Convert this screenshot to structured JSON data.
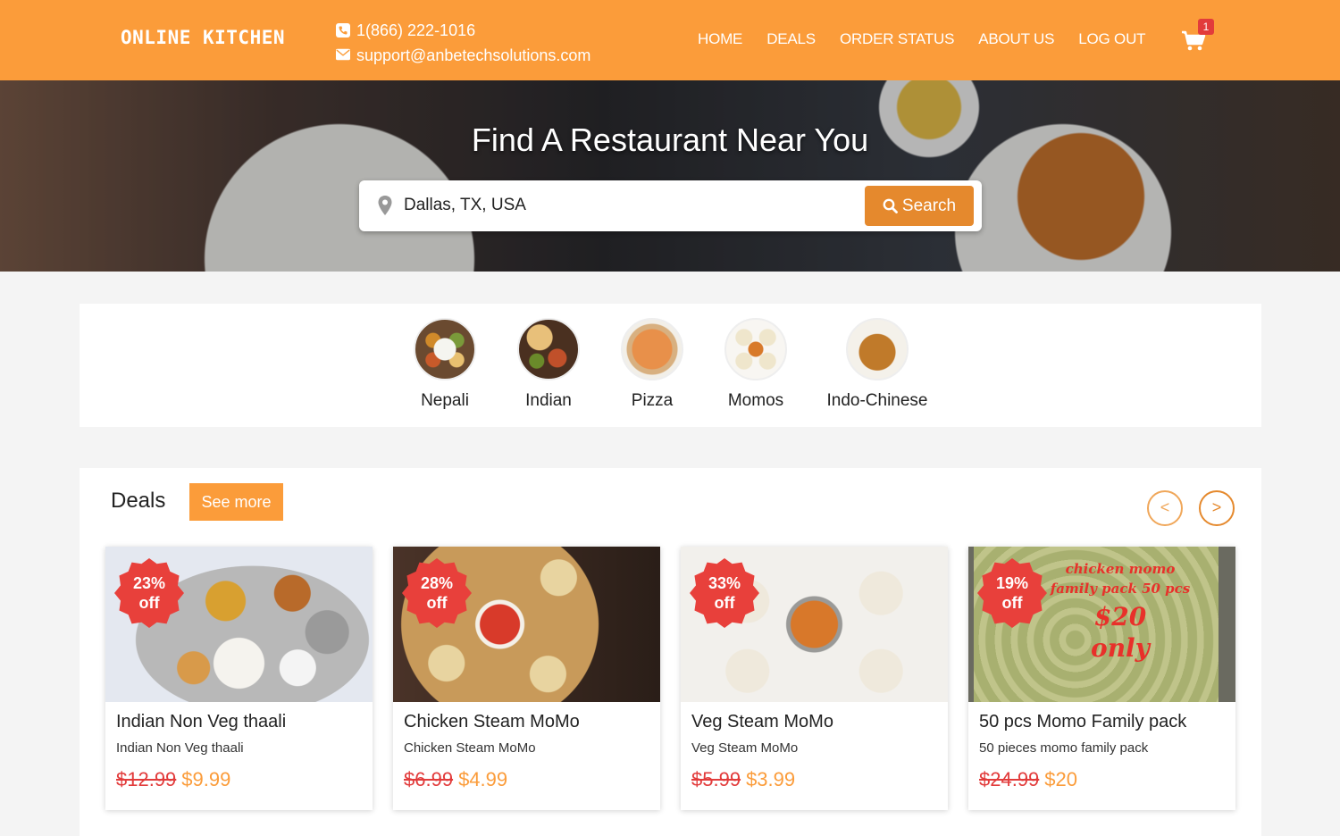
{
  "header": {
    "logo": "ONLINE KITCHEN",
    "phone": "1(866) 222-1016",
    "email": "support@anbetechsolutions.com",
    "nav": [
      "HOME",
      "DEALS",
      "ORDER STATUS",
      "ABOUT US",
      "LOG OUT"
    ],
    "cart_count": "1",
    "bg_color": "#fb9c3a"
  },
  "hero": {
    "title": "Find A Restaurant Near You",
    "location_value": "Dallas, TX, USA",
    "search_button": "Search"
  },
  "categories": [
    {
      "label": "Nepali",
      "icon": "nepali-food-image"
    },
    {
      "label": "Indian",
      "icon": "indian-food-image"
    },
    {
      "label": "Pizza",
      "icon": "pizza-image"
    },
    {
      "label": "Momos",
      "icon": "momos-image"
    },
    {
      "label": "Indo-Chinese",
      "icon": "indo-chinese-image"
    }
  ],
  "deals": {
    "title": "Deals",
    "see_more": "See more",
    "prev": "<",
    "next": ">",
    "cards": [
      {
        "discount": "23%",
        "off": "off",
        "title": "Indian Non Veg thaali",
        "subtitle": "Indian Non Veg thaali",
        "old_price": "$12.99",
        "new_price": "$9.99"
      },
      {
        "discount": "28%",
        "off": "off",
        "title": "Chicken Steam MoMo",
        "subtitle": "Chicken Steam MoMo",
        "old_price": "$6.99",
        "new_price": "$4.99"
      },
      {
        "discount": "33%",
        "off": "off",
        "title": "Veg Steam MoMo",
        "subtitle": "Veg Steam MoMo",
        "old_price": "$5.99",
        "new_price": "$3.99"
      },
      {
        "discount": "19%",
        "off": "off",
        "title": "50 pcs Momo Family pack",
        "subtitle": "50 pieces momo family pack",
        "old_price": "$24.99",
        "new_price": "$20",
        "image_text": [
          "chicken momo",
          "family pack 50 pcs",
          "$20",
          "only"
        ]
      }
    ]
  }
}
